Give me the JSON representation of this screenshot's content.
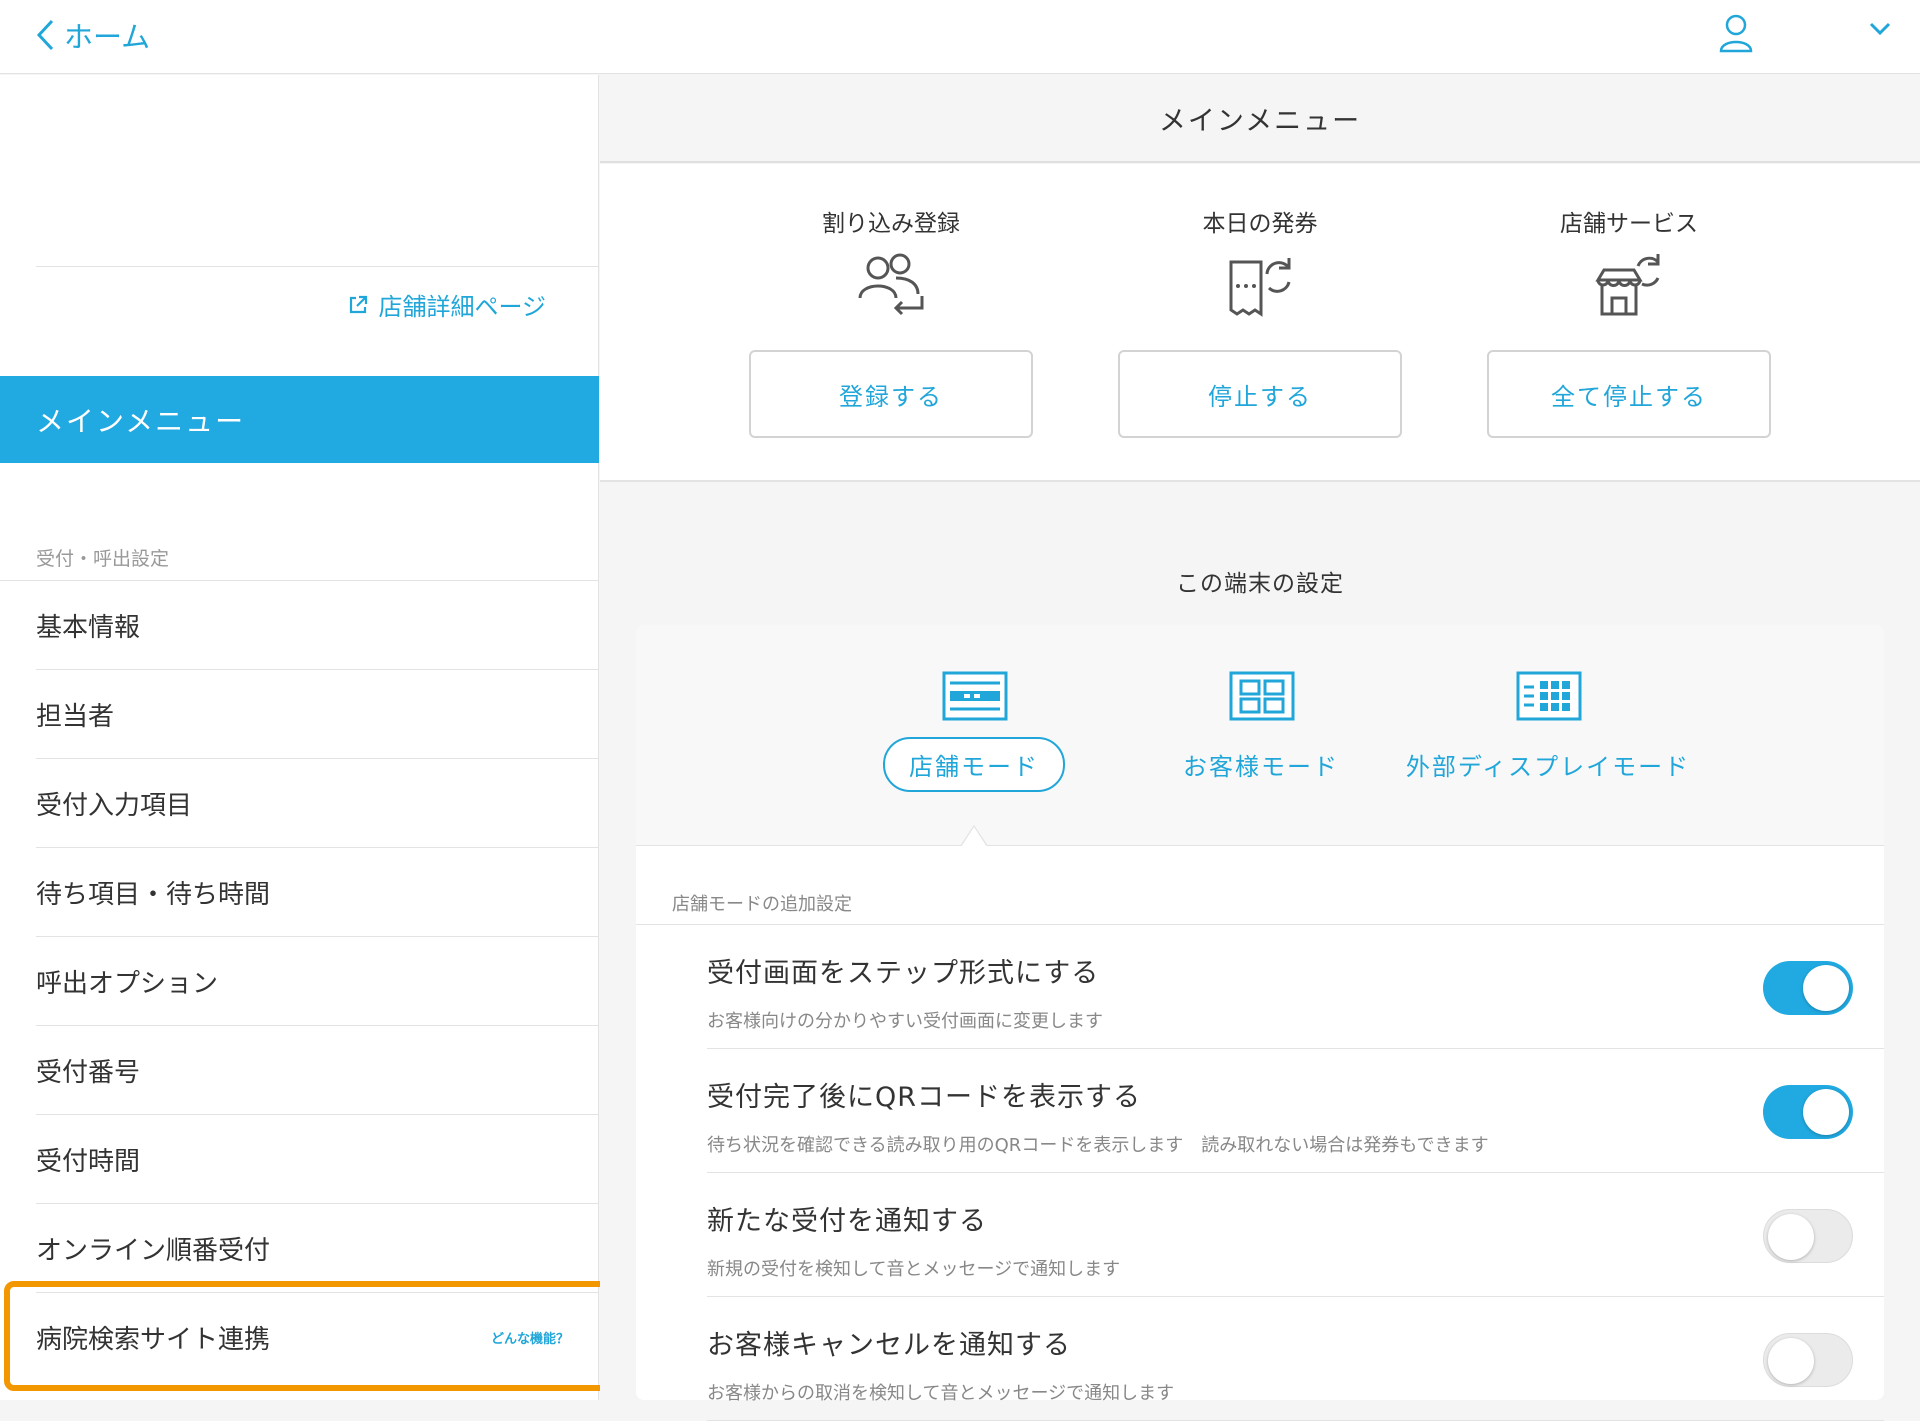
{
  "topbar": {
    "back_label": "ホーム"
  },
  "sidebar": {
    "store_link": "店舗詳細ページ",
    "active_item": "メインメニュー",
    "section_title": "受付・呼出設定",
    "items": [
      {
        "label": "基本情報"
      },
      {
        "label": "担当者"
      },
      {
        "label": "受付入力項目"
      },
      {
        "label": "待ち項目・待ち時間"
      },
      {
        "label": "呼出オプション"
      },
      {
        "label": "受付番号"
      },
      {
        "label": "受付時間"
      },
      {
        "label": "オンライン順番受付"
      },
      {
        "label": "病院検索サイト連携",
        "help": "どんな機能？"
      }
    ]
  },
  "main": {
    "header": "メインメニュー",
    "actions": [
      {
        "label": "割り込み登録",
        "icon": "users-swap-icon",
        "button": "登録する"
      },
      {
        "label": "本日の発券",
        "icon": "ticket-refresh-icon",
        "button": "停止する"
      },
      {
        "label": "店舗サービス",
        "icon": "store-refresh-icon",
        "button": "全て停止する"
      }
    ],
    "device_settings": {
      "title": "この端末の設定",
      "modes": [
        {
          "label": "店舗モード",
          "icon": "store-mode-icon",
          "selected": true
        },
        {
          "label": "お客様モード",
          "icon": "customer-mode-icon",
          "selected": false
        },
        {
          "label": "外部ディスプレイモード",
          "icon": "external-display-mode-icon",
          "selected": false
        }
      ],
      "extra_title": "店舗モードの追加設定",
      "settings": [
        {
          "title": "受付画面をステップ形式にする",
          "desc": "お客様向けの分かりやすい受付画面に変更します",
          "enabled": true
        },
        {
          "title": "受付完了後にQRコードを表示する",
          "desc": "待ち状況を確認できる読み取り用のQRコードを表示します　読み取れない場合は発券もできます",
          "enabled": true
        },
        {
          "title": "新たな受付を通知する",
          "desc": "新規の受付を検知して音とメッセージで通知します",
          "enabled": false
        },
        {
          "title": "お客様キャンセルを通知する",
          "desc": "お客様からの取消を検知して音とメッセージで通知します",
          "enabled": false
        }
      ]
    }
  },
  "colors": {
    "accent": "#21a9e1",
    "highlight": "#f39700"
  }
}
